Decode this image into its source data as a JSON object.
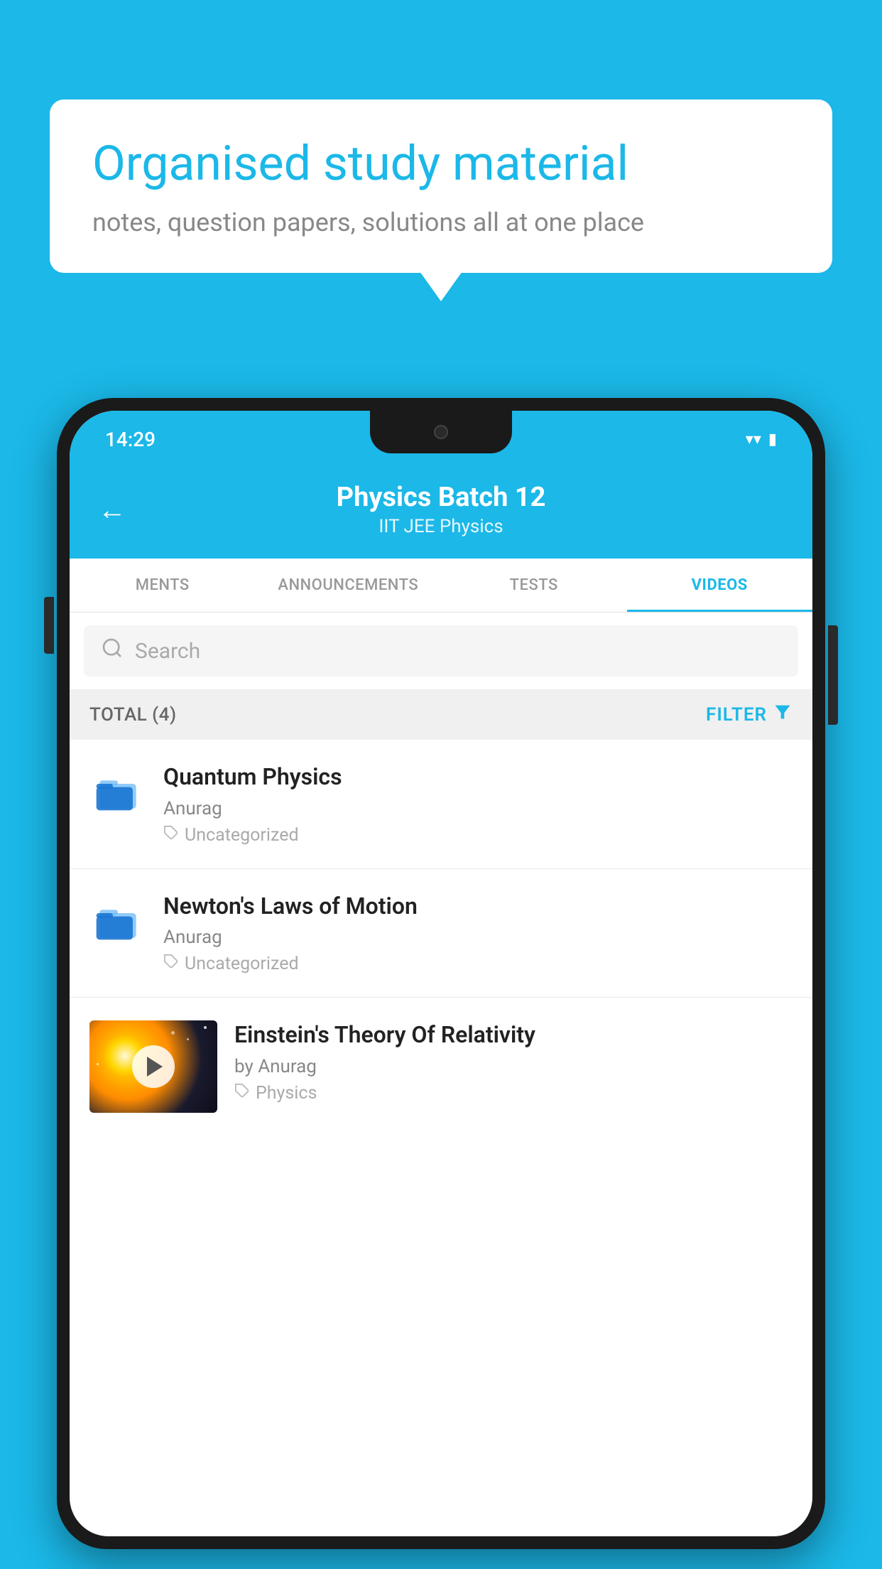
{
  "background_color": "#1bb8e8",
  "speech_bubble": {
    "title": "Organised study material",
    "subtitle": "notes, question papers, solutions all at one place"
  },
  "status_bar": {
    "time": "14:29",
    "wifi_icon": "▼",
    "signal_icon": "▲",
    "battery_icon": "▮"
  },
  "header": {
    "back_label": "←",
    "title": "Physics Batch 12",
    "subtitle": "IIT JEE   Physics"
  },
  "tabs": [
    {
      "label": "MENTS",
      "active": false
    },
    {
      "label": "ANNOUNCEMENTS",
      "active": false
    },
    {
      "label": "TESTS",
      "active": false
    },
    {
      "label": "VIDEOS",
      "active": true
    }
  ],
  "search": {
    "placeholder": "Search"
  },
  "filter_bar": {
    "total_label": "TOTAL (4)",
    "filter_label": "FILTER"
  },
  "videos": [
    {
      "id": 1,
      "title": "Quantum Physics",
      "author": "Anurag",
      "tag": "Uncategorized",
      "has_thumbnail": false
    },
    {
      "id": 2,
      "title": "Newton's Laws of Motion",
      "author": "Anurag",
      "tag": "Uncategorized",
      "has_thumbnail": false
    },
    {
      "id": 3,
      "title": "Einstein's Theory Of Relativity",
      "author": "by Anurag",
      "tag": "Physics",
      "has_thumbnail": true
    }
  ]
}
